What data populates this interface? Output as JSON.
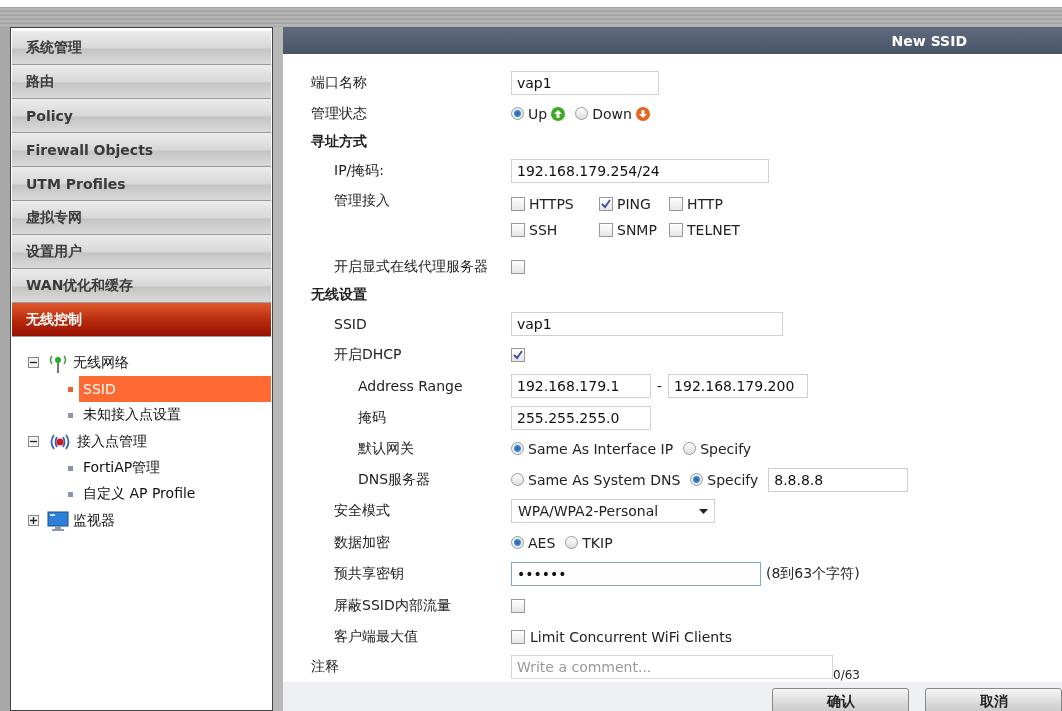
{
  "menu": [
    {
      "label": "系统管理",
      "selected": false
    },
    {
      "label": "路由",
      "selected": false
    },
    {
      "label": "Policy",
      "selected": false
    },
    {
      "label": "Firewall Objects",
      "selected": false
    },
    {
      "label": "UTM Profiles",
      "selected": false
    },
    {
      "label": "虚拟专网",
      "selected": false
    },
    {
      "label": "设置用户",
      "selected": false
    },
    {
      "label": "WAN优化和缓存",
      "selected": false
    },
    {
      "label": "无线控制",
      "selected": true
    }
  ],
  "tree": [
    {
      "label": "无线网络",
      "kind": "antenna",
      "expanded": true,
      "children": [
        {
          "label": "SSID",
          "selected": true
        },
        {
          "label": "未知接入点设置",
          "selected": false
        }
      ]
    },
    {
      "label": "接入点管理",
      "kind": "broadcast",
      "expanded": true,
      "children": [
        {
          "label": "FortiAP管理",
          "selected": false
        },
        {
          "label": "自定义 AP Profile",
          "selected": false
        }
      ]
    },
    {
      "label": "监视器",
      "kind": "monitor",
      "expanded": false
    }
  ],
  "panel": {
    "title": "New SSID"
  },
  "form": [
    {
      "kind": "text",
      "label": "端口名称",
      "value": "vap1"
    },
    {
      "kind": "radio",
      "label": "管理状态",
      "options": [
        {
          "label": "Up",
          "kind": "up",
          "selected": true
        },
        {
          "label": "Down",
          "kind": "down",
          "selected": false
        }
      ]
    },
    {
      "kind": "section",
      "label": "寻址方式",
      "children": [
        {
          "kind": "text",
          "label": "IP/掩码:",
          "value": "192.168.179.254/24"
        },
        {
          "kind": "checks",
          "label": "管理接入",
          "options": [
            {
              "label": "HTTPS",
              "checked": false
            },
            {
              "label": "PING",
              "checked": true
            },
            {
              "label": "HTTP",
              "checked": false
            },
            {
              "label": "SSH",
              "checked": false
            },
            {
              "label": "SNMP",
              "checked": false
            },
            {
              "label": "TELNET",
              "checked": false
            }
          ]
        },
        {
          "kind": "check",
          "label": "开启显式在线代理服务器",
          "checked": false
        }
      ]
    },
    {
      "kind": "section",
      "label": "无线设置",
      "children": [
        {
          "kind": "text",
          "label": "SSID",
          "value": "vap1"
        },
        {
          "kind": "check",
          "label": "开启DHCP",
          "checked": true,
          "children": [
            {
              "kind": "range",
              "label": "Address Range",
              "from": "192.168.179.1",
              "separator": "-",
              "to": "192.168.179.200"
            },
            {
              "kind": "text",
              "label": "掩码",
              "value": "255.255.255.0"
            },
            {
              "kind": "radio",
              "label": "默认网关",
              "options": [
                {
                  "label": "Same As Interface IP",
                  "selected": true
                },
                {
                  "label": "Specify",
                  "selected": false
                }
              ]
            },
            {
              "kind": "radio",
              "label": "DNS服务器",
              "options": [
                {
                  "label": "Same As System DNS",
                  "selected": false
                },
                {
                  "label": "Specify",
                  "selected": true
                }
              ],
              "value": "8.8.8.8"
            }
          ]
        },
        {
          "kind": "select",
          "label": "安全模式",
          "value": "WPA/WPA2-Personal"
        },
        {
          "kind": "radio",
          "label": "数据加密",
          "options": [
            {
              "label": "AES",
              "selected": true
            },
            {
              "label": "TKIP",
              "selected": false
            }
          ]
        },
        {
          "kind": "password",
          "label": "预共享密钥",
          "value": "••••••",
          "hint": "(8到63个字符)"
        },
        {
          "kind": "check",
          "label": "屏蔽SSID内部流量",
          "checked": false
        },
        {
          "kind": "check",
          "label": "客户端最大值",
          "checked": false,
          "text": "Limit Concurrent WiFi Clients"
        }
      ]
    },
    {
      "kind": "textarea",
      "label": "注释",
      "placeholder": "Write a comment...",
      "counter": "0/63"
    }
  ],
  "buttons": [
    "确认",
    "取消"
  ]
}
